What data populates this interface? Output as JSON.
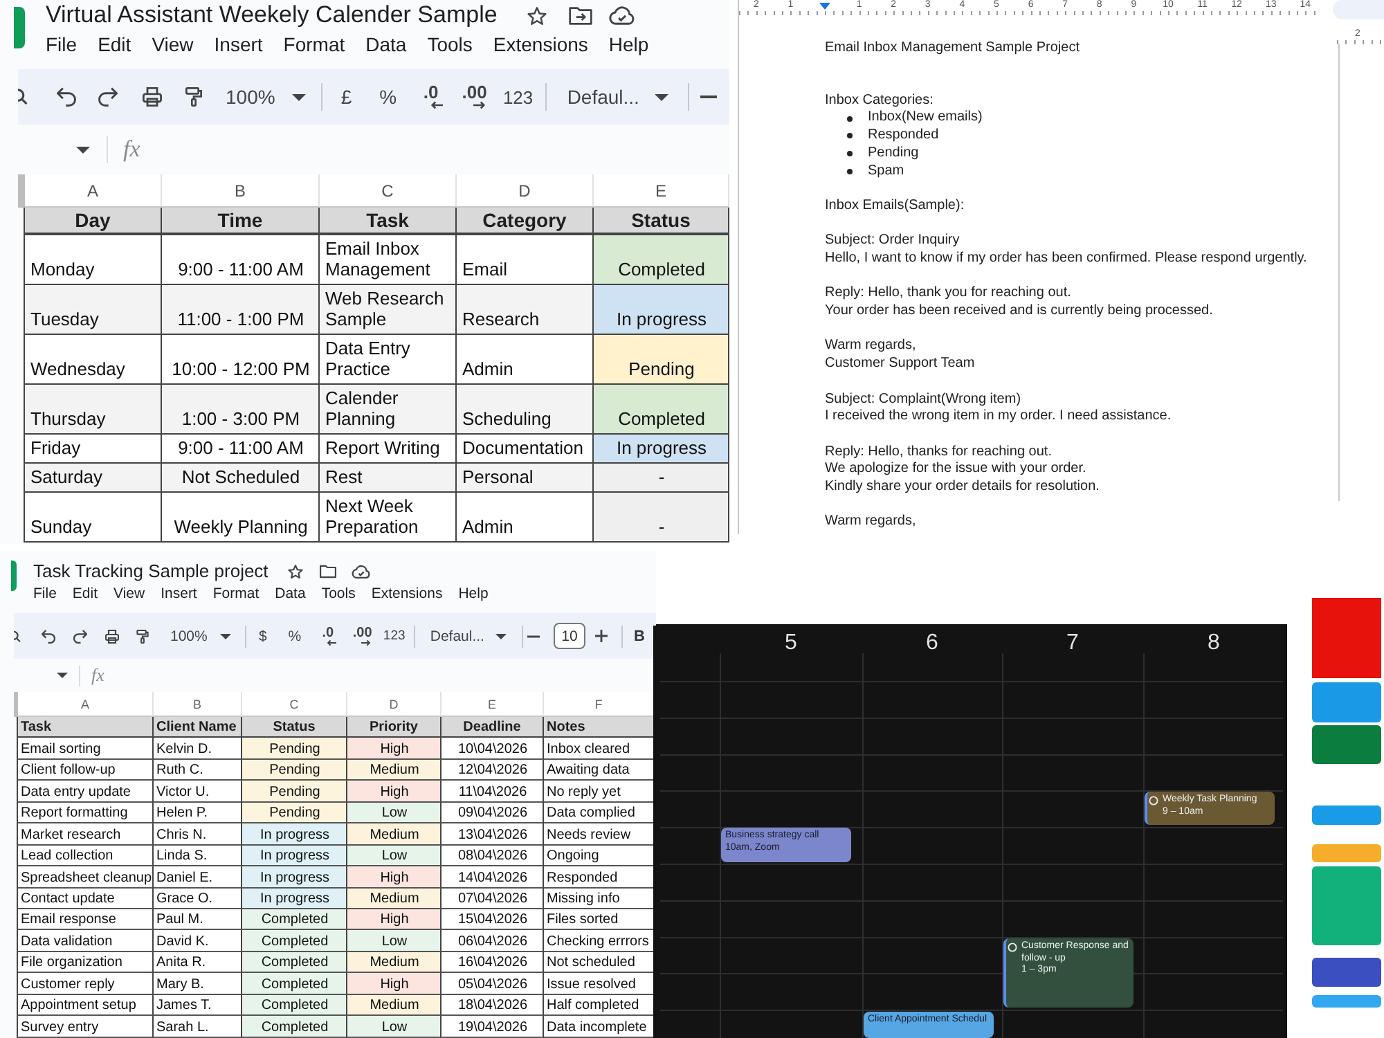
{
  "weekly_calendar_sheet": {
    "title": "Virtual Assistant Weekely Calender Sample",
    "menu": [
      "File",
      "Edit",
      "View",
      "Insert",
      "Format",
      "Data",
      "Tools",
      "Extensions",
      "Help"
    ],
    "toolbar": {
      "zoom": "100%",
      "currency": "£",
      "percent": "%",
      "decrease_decimals": ".0",
      "increase_decimals": ".00",
      "number_format": "123",
      "font": "Defaul..."
    },
    "formula_label": "fx",
    "column_letters": [
      "A",
      "B",
      "C",
      "D",
      "E"
    ],
    "headers": [
      "Day",
      "Time",
      "Task",
      "Category",
      "Status"
    ],
    "rows": [
      {
        "day": "Monday",
        "time": "9:00 - 11:00 AM",
        "task": "Email Inbox Management",
        "category": "Email",
        "status": {
          "text": "Completed",
          "color": "#d9ead3"
        }
      },
      {
        "day": "Tuesday",
        "time": "11:00 - 1:00 PM",
        "task": "Web Research Sample",
        "category": "Research",
        "status": {
          "text": "In progress",
          "color": "#cfe2f3"
        }
      },
      {
        "day": "Wednesday",
        "time": "10:00 - 12:00 PM",
        "task": "Data Entry Practice",
        "category": "Admin",
        "status": {
          "text": "Pending",
          "color": "#fff2cc"
        }
      },
      {
        "day": "Thursday",
        "time": "1:00 - 3:00 PM",
        "task": "Calender Planning",
        "category": "Scheduling",
        "status": {
          "text": "Completed",
          "color": "#d9ead3"
        }
      },
      {
        "day": "Friday",
        "time": "9:00 - 11:00 AM",
        "task": "Report Writing",
        "category": "Documentation",
        "status": {
          "text": "In progress",
          "color": "#cfe2f3"
        }
      },
      {
        "day": "Saturday",
        "time": "Not Scheduled",
        "task": "Rest",
        "category": "Personal",
        "status": {
          "text": "-",
          "color": "#efefef"
        }
      },
      {
        "day": "Sunday",
        "time": "Weekly Planning",
        "task": "Next Week Preparation",
        "category": "Admin",
        "status": {
          "text": "-",
          "color": "#efefef"
        }
      }
    ]
  },
  "email_doc": {
    "ruler": {
      "before_marker": [
        "2",
        "1"
      ],
      "after_marker": [
        "1",
        "2",
        "3",
        "4",
        "5",
        "6",
        "7",
        "8",
        "9",
        "10",
        "11",
        "12",
        "13",
        "14"
      ]
    },
    "title": "Email Inbox Management Sample Project",
    "blocks": [
      {
        "lines": [
          "Inbox Categories:"
        ],
        "bullets": [
          "Inbox(New emails)",
          "Responded",
          "Pending",
          "Spam"
        ]
      },
      {
        "lines": [
          "Inbox Emails(Sample):"
        ]
      },
      {
        "lines": [
          "Subject: Order Inquiry",
          "Hello, I want to know if my order has been confirmed. Please respond urgently."
        ]
      },
      {
        "lines": [
          "Reply: Hello, thank you for reaching out.",
          "Your order has been received and is currently being processed."
        ]
      },
      {
        "lines": [
          "Warm regards,",
          "Customer Support Team"
        ]
      },
      {
        "lines": [
          "Subject: Complaint(Wrong item)",
          "I received the wrong item in my order. I need assistance."
        ]
      },
      {
        "lines": [
          "Reply: Hello, thanks for reaching out.",
          "We apologize for the issue with your order.",
          "Kindly share your order details for resolution."
        ]
      },
      {
        "lines": [
          "Warm regards,"
        ]
      }
    ]
  },
  "side_page": {
    "ruler_number": "2"
  },
  "task_sheet": {
    "title": "Task Tracking Sample project",
    "menu": [
      "File",
      "Edit",
      "View",
      "Insert",
      "Format",
      "Data",
      "Tools",
      "Extensions",
      "Help"
    ],
    "toolbar": {
      "zoom": "100%",
      "currency": "$",
      "percent": "%",
      "decrease_decimals": ".0",
      "increase_decimals": ".00",
      "number_format": "123",
      "font": "Defaul...",
      "font_size": "10",
      "bold": "B"
    },
    "formula_label": "fx",
    "column_letters": [
      "A",
      "B",
      "C",
      "D",
      "E",
      "F"
    ],
    "headers": [
      "Task",
      "Client Name",
      "Status",
      "Priority",
      "Deadline",
      "Notes"
    ],
    "rows": [
      {
        "task": "Email sorting",
        "client": "Kelvin D.",
        "status": {
          "text": "Pending",
          "color": "#fdf4de"
        },
        "priority": {
          "text": "High",
          "color": "#fce4df"
        },
        "deadline": "10\\04\\2026",
        "notes": "Inbox cleared"
      },
      {
        "task": "Client follow-up",
        "client": "Ruth C.",
        "status": {
          "text": "Pending",
          "color": "#fdf4de"
        },
        "priority": {
          "text": "Medium",
          "color": "#fdf3dc"
        },
        "deadline": "12\\04\\2026",
        "notes": "Awaiting data"
      },
      {
        "task": "Data entry update",
        "client": "Victor U.",
        "status": {
          "text": "Pending",
          "color": "#fdf4de"
        },
        "priority": {
          "text": "High",
          "color": "#fce4df"
        },
        "deadline": "11\\04\\2026",
        "notes": "No reply yet"
      },
      {
        "task": "Report formatting",
        "client": "Helen P.",
        "status": {
          "text": "Pending",
          "color": "#fdf4de"
        },
        "priority": {
          "text": "Low",
          "color": "#e6f4ea"
        },
        "deadline": "09\\04\\2026",
        "notes": "Data complied"
      },
      {
        "task": "Market research",
        "client": "Chris N.",
        "status": {
          "text": "In progress",
          "color": "#dff1f7"
        },
        "priority": {
          "text": "Medium",
          "color": "#fdf3dc"
        },
        "deadline": "13\\04\\2026",
        "notes": "Needs review"
      },
      {
        "task": "Lead collection",
        "client": "Linda S.",
        "status": {
          "text": "In progress",
          "color": "#dff1f7"
        },
        "priority": {
          "text": "Low",
          "color": "#e6f4ea"
        },
        "deadline": "08\\04\\2026",
        "notes": "Ongoing"
      },
      {
        "task": "Spreadsheet cleanup",
        "client": "Daniel E.",
        "status": {
          "text": "In progress",
          "color": "#dff1f7"
        },
        "priority": {
          "text": "High",
          "color": "#fce4df"
        },
        "deadline": "14\\04\\2026",
        "notes": "Responded"
      },
      {
        "task": "Contact update",
        "client": "Grace O.",
        "status": {
          "text": "In progress",
          "color": "#dff1f7"
        },
        "priority": {
          "text": "Medium",
          "color": "#fdf3dc"
        },
        "deadline": "07\\04\\2026",
        "notes": "Missing info"
      },
      {
        "task": "Email response",
        "client": "Paul M.",
        "status": {
          "text": "Completed",
          "color": "#e6f4ea"
        },
        "priority": {
          "text": "High",
          "color": "#fce4df"
        },
        "deadline": "15\\04\\2026",
        "notes": "Files sorted"
      },
      {
        "task": "Data validation",
        "client": "David K.",
        "status": {
          "text": "Completed",
          "color": "#e6f4ea"
        },
        "priority": {
          "text": "Low",
          "color": "#e6f4ea"
        },
        "deadline": "06\\04\\2026",
        "notes": "Checking errrors"
      },
      {
        "task": "File organization",
        "client": "Anita R.",
        "status": {
          "text": "Completed",
          "color": "#e6f4ea"
        },
        "priority": {
          "text": "Medium",
          "color": "#fdf3dc"
        },
        "deadline": "16\\04\\2026",
        "notes": "Not scheduled"
      },
      {
        "task": "Customer reply",
        "client": "Mary B.",
        "status": {
          "text": "Completed",
          "color": "#e6f4ea"
        },
        "priority": {
          "text": "High",
          "color": "#fce4df"
        },
        "deadline": "05\\04\\2026",
        "notes": "Issue resolved"
      },
      {
        "task": "Appointment setup",
        "client": "James T.",
        "status": {
          "text": "Completed",
          "color": "#e6f4ea"
        },
        "priority": {
          "text": "Medium",
          "color": "#fdf3dc"
        },
        "deadline": "18\\04\\2026",
        "notes": "Half completed"
      },
      {
        "task": "Survey entry",
        "client": "Sarah L.",
        "status": {
          "text": "Completed",
          "color": "#e6f4ea"
        },
        "priority": {
          "text": "Low",
          "color": "#e6f4ea"
        },
        "deadline": "19\\04\\2026",
        "notes": "Data incomplete"
      }
    ]
  },
  "calendar": {
    "days": [
      {
        "label": "5",
        "events": [
          {
            "kind": "event",
            "title": "Business strategy call",
            "time": "10am, Zoom",
            "color": "#7b86cc"
          }
        ]
      },
      {
        "label": "6",
        "events": [
          {
            "kind": "event",
            "title": "Client Appointment Schedul",
            "color": "#56a6e3"
          }
        ]
      },
      {
        "label": "7",
        "events": [
          {
            "kind": "task",
            "title": "Customer Response and follow - up",
            "time": "1 – 3pm",
            "color": "#33503e"
          }
        ]
      },
      {
        "label": "8",
        "events": [
          {
            "kind": "task",
            "title": "Weekly Task Planning",
            "time": "9 – 10am",
            "color": "#6b5934"
          }
        ]
      }
    ]
  }
}
